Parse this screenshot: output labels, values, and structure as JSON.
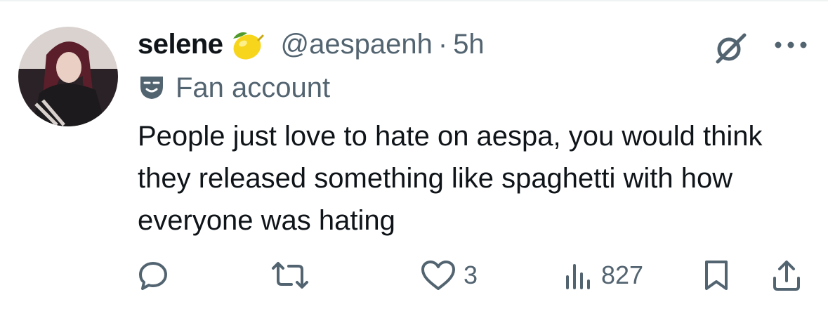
{
  "tweet": {
    "display_name": "selene",
    "emoji_icon": "lemon-icon",
    "handle": "@aespaenh",
    "separator": "·",
    "time": "5h",
    "label_icon": "theater-mask-icon",
    "label": "Fan account",
    "text": "People just love to hate on aespa, you would think they released something like spaghetti with how everyone was hating"
  },
  "actions": {
    "reply": {
      "icon": "reply-icon",
      "count": ""
    },
    "retweet": {
      "icon": "retweet-icon",
      "count": ""
    },
    "like": {
      "icon": "heart-icon",
      "count": "3"
    },
    "views": {
      "icon": "views-icon",
      "count": "827"
    },
    "bookmark": {
      "icon": "bookmark-icon"
    },
    "share": {
      "icon": "share-icon"
    }
  },
  "colors": {
    "text": "#0f1419",
    "secondary": "#536471",
    "lemon": "#f7d51d"
  }
}
